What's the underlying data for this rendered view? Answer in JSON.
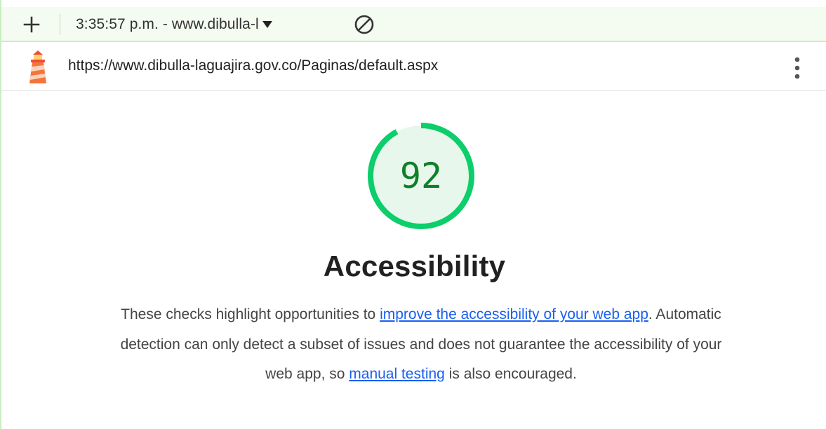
{
  "toolbar": {
    "report_label": "3:35:57 p.m. - www.dibulla-l",
    "icons": [
      "plus-icon",
      "caret-down-icon",
      "block-icon"
    ]
  },
  "urlbar": {
    "url": "https://www.dibulla-laguajira.gov.co/Paginas/default.aspx",
    "icons": [
      "lighthouse-icon",
      "kebab-menu-icon"
    ]
  },
  "gauge": {
    "score": "92",
    "score_value": 92,
    "color": "#0cce6b",
    "fill_color": "#e8f7ec",
    "text_color": "#0f7f2a"
  },
  "category": {
    "title": "Accessibility"
  },
  "description": {
    "part1": "These checks highlight opportunities to ",
    "link1": "improve the accessibility of your web app",
    "part2": ". Automatic detection can only detect a subset of issues and does not guarantee the accessibility of your web app, so ",
    "link2": "manual testing",
    "part3": " is also encouraged."
  },
  "colors": {
    "toolbar_bg": "#f4fbf0",
    "toolbar_border": "#c9eec1",
    "link": "#1a5ff0"
  }
}
